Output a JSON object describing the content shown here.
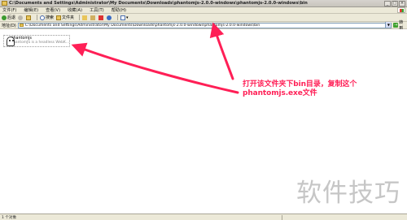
{
  "window": {
    "title": "C:\\Documents and Settings\\Administrator\\My Documents\\Downloads\\phantomjs-2.0.0-windows\\phantomjs-2.0.0-windows\\bin"
  },
  "menu": {
    "items": [
      "文件(F)",
      "编辑(E)",
      "查看(V)",
      "收藏(A)",
      "工具(T)",
      "帮助(H)"
    ]
  },
  "toolbar": {
    "back_label": "后退",
    "search_label": "搜索",
    "folders_label": "文件夹"
  },
  "address": {
    "label": "地址(D)",
    "value": "C:\\Documents and Settings\\Administrator\\My Documents\\Downloads\\phantomjs-2.0.0-windows\\phantomjs-2.0.0-windows\\bin",
    "go_label": "转到"
  },
  "files": [
    {
      "name": "phantomjs",
      "description": "PhantomJS is a headless WebK..."
    }
  ],
  "annotation": {
    "line1": "打开该文件夹下bin目录，复制这个",
    "line2": "phantomjs.exe文件",
    "color": "#ff1f56"
  },
  "watermark": "软件技巧",
  "status": {
    "text": "1 个对象"
  }
}
